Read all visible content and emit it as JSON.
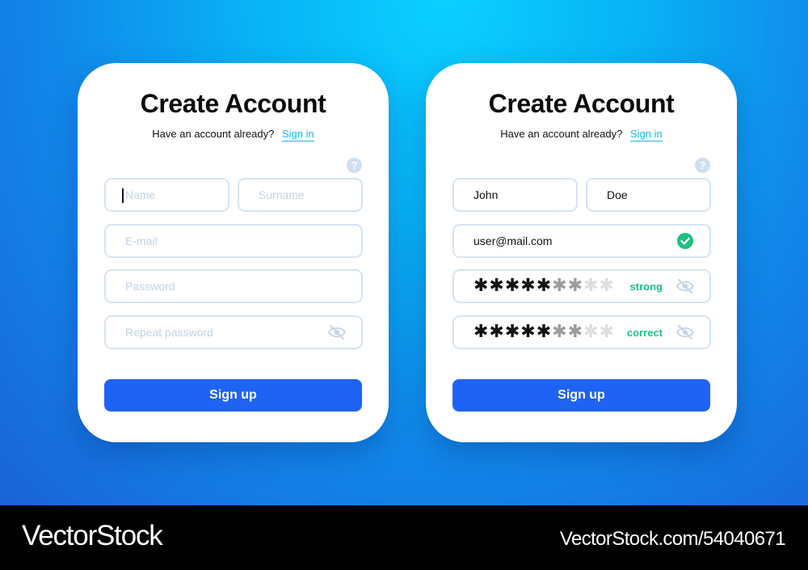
{
  "left_form": {
    "title": "Create Account",
    "subtitle": "Have an account already?",
    "sign_in_link": "Sign in",
    "help_icon": "?",
    "name_placeholder": "Name",
    "surname_placeholder": "Surname",
    "email_placeholder": "E-mail",
    "password_placeholder": "Password",
    "repeat_password_placeholder": "Repeat password",
    "signup_label": "Sign up"
  },
  "right_form": {
    "title": "Create Account",
    "subtitle": "Have an account already?",
    "sign_in_link": "Sign in",
    "help_icon": "?",
    "name_value": "John",
    "surname_value": "Doe",
    "email_value": "user@mail.com",
    "password_status": "strong",
    "repeat_password_status": "correct",
    "signup_label": "Sign up"
  },
  "icons": {
    "help": "help-icon",
    "eye_hidden": "eye-slash-icon",
    "valid": "check-circle-icon"
  },
  "colors": {
    "accent": "#1f63f5",
    "link": "#17b6ea",
    "success": "#1fbf82",
    "field_border": "#d6e4f3"
  },
  "footer": {
    "brand": "VectorStock",
    "url": "VectorStock.com/54040671"
  }
}
